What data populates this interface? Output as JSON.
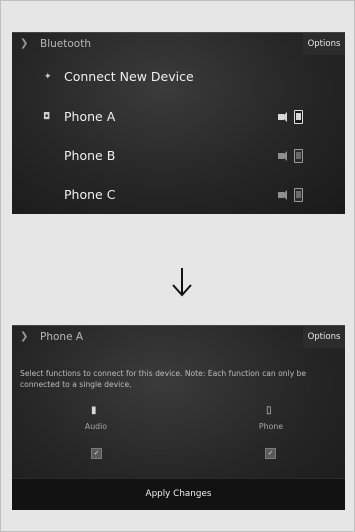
{
  "screen1": {
    "title": "Bluetooth",
    "options_label": "Options",
    "items": [
      {
        "label": "Connect New Device",
        "icon": "plus-sparkle-icon"
      },
      {
        "label": "Phone A",
        "icon": "connected-phone-icon",
        "active": true
      },
      {
        "label": "Phone B"
      },
      {
        "label": "Phone C"
      }
    ]
  },
  "screen2": {
    "title": "Phone A",
    "options_label": "Options",
    "description": "Select functions to connect for this device. Note: Each function can only be connected to a single device.",
    "functions": [
      {
        "label": "Audio",
        "icon": "speaker-icon",
        "checked": true
      },
      {
        "label": "Phone",
        "icon": "phone-icon",
        "checked": true
      }
    ],
    "apply_label": "Apply Changes"
  },
  "transition_icon": "down-arrow-icon"
}
